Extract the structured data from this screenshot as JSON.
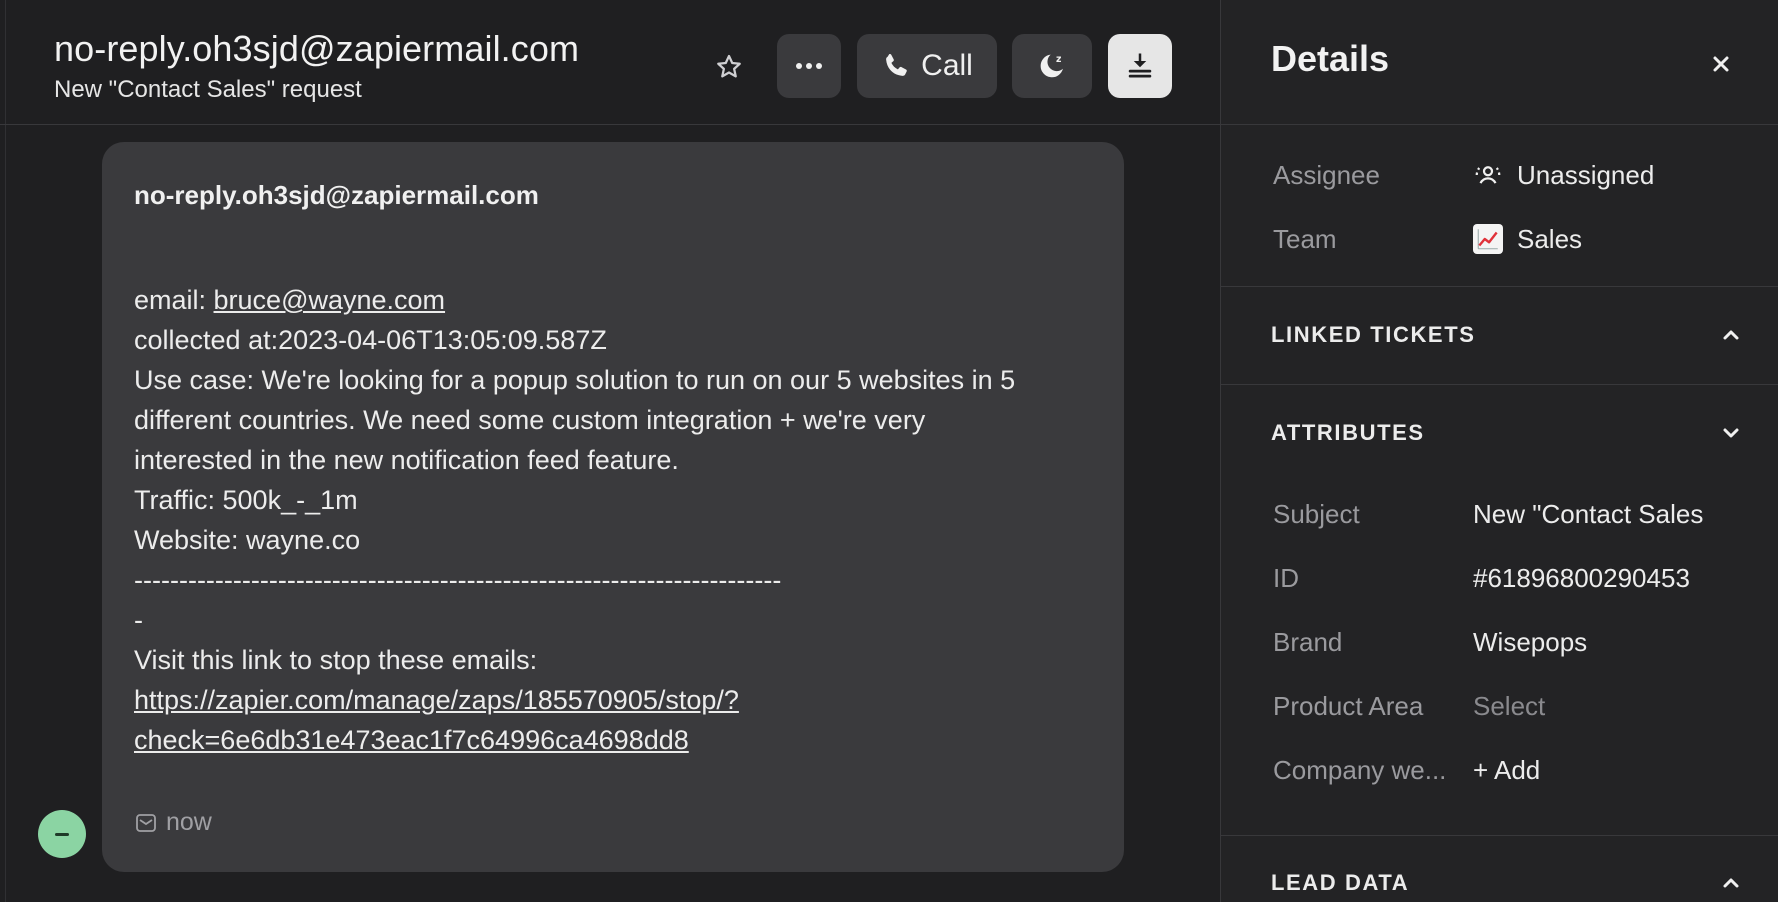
{
  "conversation": {
    "title": "no-reply.oh3sjd@zapiermail.com",
    "subtitle": "New \"Contact Sales\" request",
    "toolbar": {
      "call_label": "Call"
    },
    "message": {
      "sender": "no-reply.oh3sjd@zapiermail.com",
      "email_prefix": "email: ",
      "email_link": "bruce@wayne.com",
      "collected": "collected at:2023-04-06T13:05:09.587Z",
      "use_case_1": "Use case: We're looking for a popup solution to run on our 5 websites in 5",
      "use_case_2": "different countries. We need some custom integration + we're very",
      "use_case_3": "interested in the new notification feed feature.",
      "traffic": "Traffic: 500k_-_1m",
      "website": "Website: wayne.co",
      "separator": "------------------------------------------------------------------------",
      "separator_tail": "-",
      "stop_text": "Visit this link to stop these emails:",
      "stop_link_1": "https://zapier.com/manage/zaps/185570905/stop/?",
      "stop_link_2": "check=6e6db31e473eac1f7c64996ca4698dd8",
      "time": "now"
    }
  },
  "details": {
    "title": "Details",
    "assignee_label": "Assignee",
    "assignee_value": "Unassigned",
    "team_label": "Team",
    "team_value": "Sales",
    "linked_tickets_label": "LINKED TICKETS",
    "attributes_label": "ATTRIBUTES",
    "attributes": {
      "subject_label": "Subject",
      "subject_value": "New \"Contact Sales",
      "id_label": "ID",
      "id_value": "#61896800290453",
      "brand_label": "Brand",
      "brand_value": "Wisepops",
      "product_area_label": "Product Area",
      "product_area_value": "Select",
      "company_label": "Company we...",
      "company_value": "+ Add"
    },
    "lead_data_label": "LEAD DATA"
  },
  "colors": {
    "background": "#1f1f21",
    "panel": "#232325",
    "card": "#3a3a3d",
    "status_green": "#8bd4a3"
  },
  "icons": [
    "star-icon",
    "more-icon",
    "phone-icon",
    "snooze-icon",
    "close-ticket-icon",
    "close-icon",
    "unassigned-icon",
    "chart-emoji-icon",
    "chevron-up-icon",
    "chevron-down-icon",
    "email-channel-icon"
  ]
}
